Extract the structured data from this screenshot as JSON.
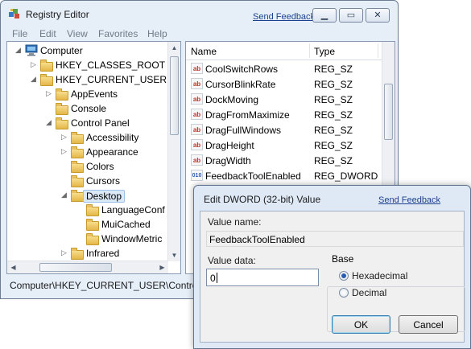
{
  "main_window": {
    "title": "Registry Editor",
    "send_feedback": "Send Feedback",
    "menu": [
      "File",
      "Edit",
      "View",
      "Favorites",
      "Help"
    ],
    "status_path": "Computer\\HKEY_CURRENT_USER\\Control P"
  },
  "tree": {
    "items": [
      {
        "label": "Computer",
        "icon": "computer-icon",
        "expander": "expanded"
      },
      {
        "label": "HKEY_CLASSES_ROOT",
        "icon": "folder-icon",
        "expander": "collapsed"
      },
      {
        "label": "HKEY_CURRENT_USER",
        "icon": "folder-icon",
        "expander": "expanded"
      },
      {
        "label": "AppEvents",
        "icon": "folder-icon",
        "expander": "collapsed"
      },
      {
        "label": "Console",
        "icon": "folder-icon",
        "expander": "none"
      },
      {
        "label": "Control Panel",
        "icon": "folder-icon",
        "expander": "expanded"
      },
      {
        "label": "Accessibility",
        "icon": "folder-icon",
        "expander": "collapsed"
      },
      {
        "label": "Appearance",
        "icon": "folder-icon",
        "expander": "collapsed"
      },
      {
        "label": "Colors",
        "icon": "folder-icon",
        "expander": "none"
      },
      {
        "label": "Cursors",
        "icon": "folder-icon",
        "expander": "none"
      },
      {
        "label": "Desktop",
        "icon": "folder-icon",
        "expander": "expanded",
        "selected": true
      },
      {
        "label": "LanguageConf",
        "icon": "folder-icon",
        "expander": "none"
      },
      {
        "label": "MuiCached",
        "icon": "folder-icon",
        "expander": "none"
      },
      {
        "label": "WindowMetric",
        "icon": "folder-icon",
        "expander": "none"
      },
      {
        "label": "Infrared",
        "icon": "folder-icon",
        "expander": "collapsed"
      }
    ]
  },
  "values_list": {
    "columns": [
      "Name",
      "Type"
    ],
    "rows": [
      {
        "name": "CoolSwitchRows",
        "type": "REG_SZ",
        "icon": "ab"
      },
      {
        "name": "CursorBlinkRate",
        "type": "REG_SZ",
        "icon": "ab"
      },
      {
        "name": "DockMoving",
        "type": "REG_SZ",
        "icon": "ab"
      },
      {
        "name": "DragFromMaximize",
        "type": "REG_SZ",
        "icon": "ab"
      },
      {
        "name": "DragFullWindows",
        "type": "REG_SZ",
        "icon": "ab"
      },
      {
        "name": "DragHeight",
        "type": "REG_SZ",
        "icon": "ab"
      },
      {
        "name": "DragWidth",
        "type": "REG_SZ",
        "icon": "ab"
      },
      {
        "name": "FeedbackToolEnabled",
        "type": "REG_DWORD",
        "icon": "010"
      }
    ]
  },
  "dialog": {
    "title": "Edit DWORD (32-bit) Value",
    "send_feedback": "Send Feedback",
    "value_name_label": "Value name:",
    "value_name": "FeedbackToolEnabled",
    "value_data_label": "Value data:",
    "value_data": "0",
    "base_label": "Base",
    "base_options": [
      "Hexadecimal",
      "Decimal"
    ],
    "base_selected": "Hexadecimal",
    "ok_label": "OK",
    "cancel_label": "Cancel"
  },
  "colors": {
    "title_bar_bg": "#e6eef8",
    "link": "#1c3f8f",
    "selection": "#dbe8f6",
    "reg_sz_icon": "#c2352a",
    "reg_dword_icon": "#2a5bb0"
  }
}
